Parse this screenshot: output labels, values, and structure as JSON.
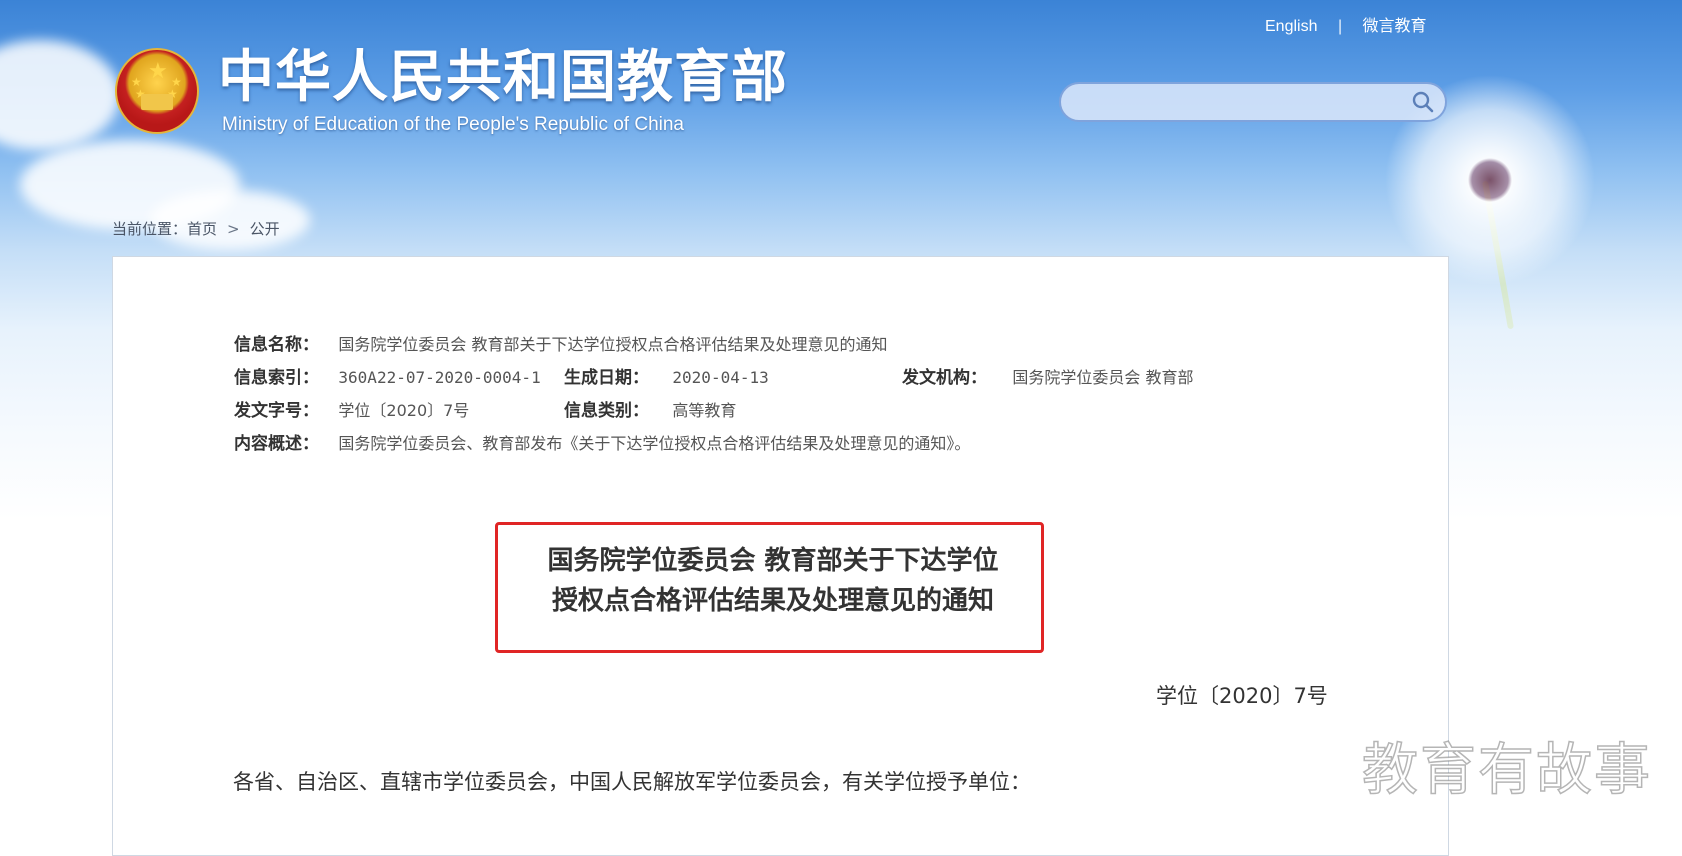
{
  "header": {
    "title_cn": "中华人民共和国教育部",
    "title_en": "Ministry of Education of the People's Republic of China",
    "links": {
      "english": "English",
      "separator": "|",
      "weiyan": "微言教育"
    },
    "search": {
      "placeholder": ""
    }
  },
  "breadcrumb": {
    "prefix": "当前位置：",
    "home": "首页",
    "arrow": ">",
    "current": "公开"
  },
  "info": {
    "name_label": "信息名称：",
    "name_value": "国务院学位委员会 教育部关于下达学位授权点合格评估结果及处理意见的通知",
    "index_label": "信息索引：",
    "index_value": "360A22-07-2020-0004-1",
    "date_label": "生成日期：",
    "date_value": "2020-04-13",
    "org_label": "发文机构：",
    "org_value": "国务院学位委员会 教育部",
    "docno_label": "发文字号：",
    "docno_value": "学位〔2020〕7号",
    "category_label": "信息类别：",
    "category_value": "高等教育",
    "summary_label": "内容概述：",
    "summary_value": "国务院学位委员会、教育部发布《关于下达学位授权点合格评估结果及处理意见的通知》。"
  },
  "document": {
    "title_line1": "国务院学位委员会 教育部关于下达学位",
    "title_line2": "授权点合格评估结果及处理意见的通知",
    "number": "学位〔2020〕7号",
    "salutation": "各省、自治区、直辖市学位委员会，中国人民解放军学位委员会，有关学位授予单位："
  },
  "watermark": "教育有故事",
  "colors": {
    "highlight_border": "#e02525",
    "sky_top": "#3b83d6"
  }
}
